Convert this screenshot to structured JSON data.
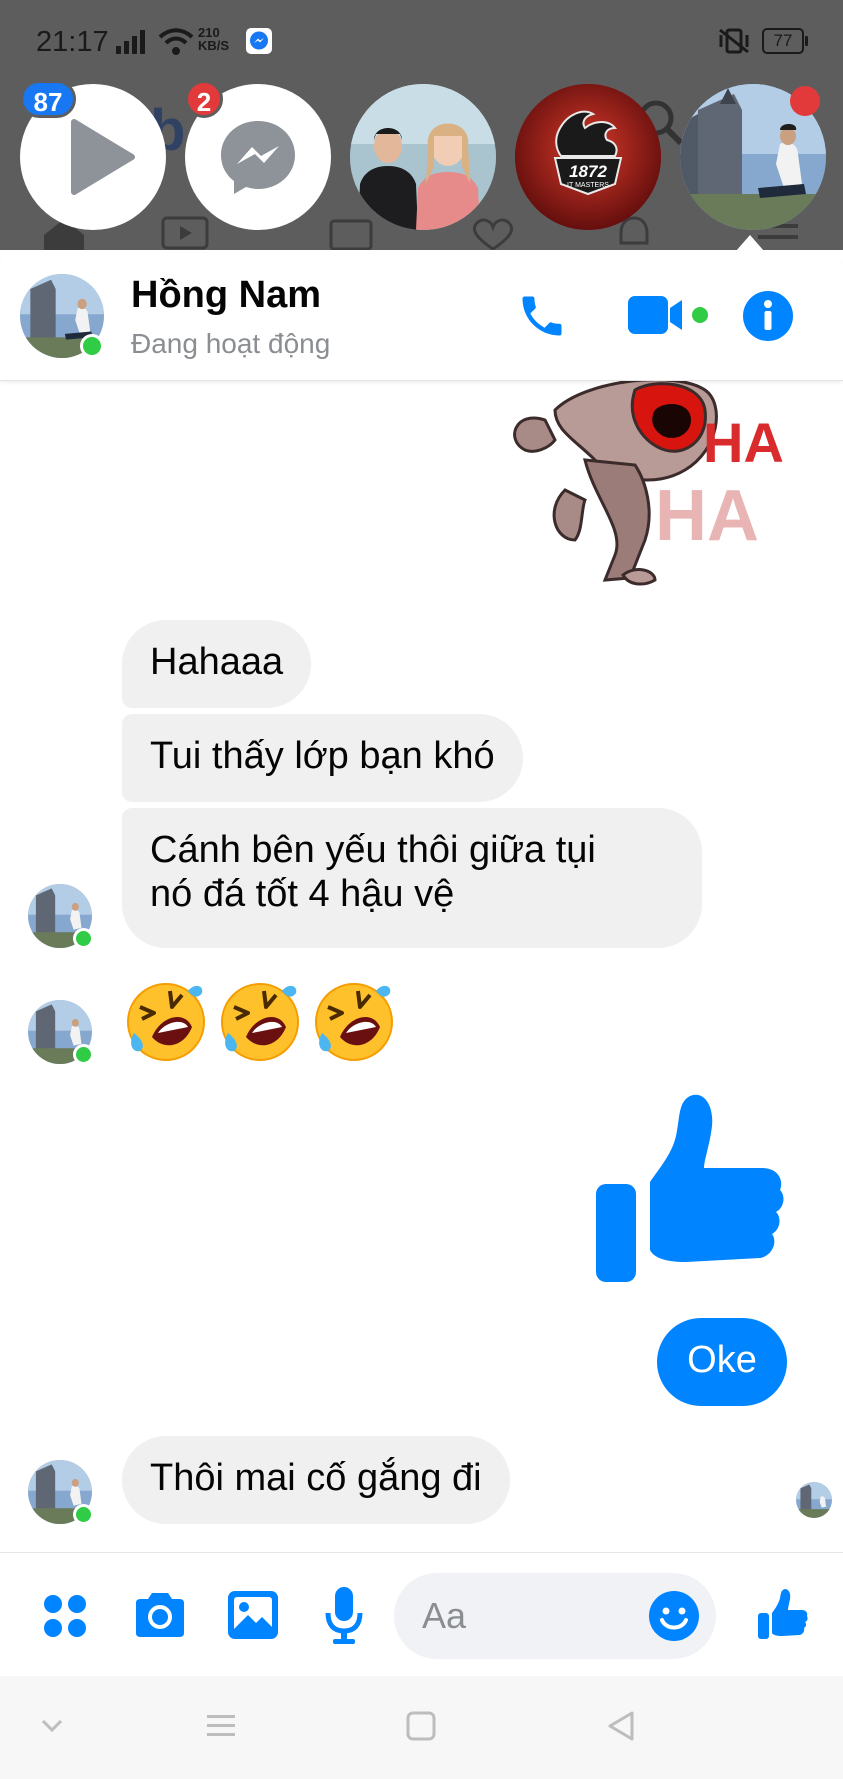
{
  "status_bar": {
    "time": "21:17",
    "speed_value": "210",
    "speed_unit": "KB/S",
    "battery": "77"
  },
  "chat_heads": {
    "video_badge": "87",
    "messenger_badge": "2",
    "logo_text": "1872",
    "logo_subtext": "IT MASTERS"
  },
  "header": {
    "name": "Hồng Nam",
    "status": "Đang hoạt động"
  },
  "sticker": {
    "text_1": "HA",
    "text_2": "HA"
  },
  "messages": {
    "m1": "Hahaaa",
    "m2": "Tui thấy lớp bạn khó",
    "m3_line1": "Cánh bên yếu thôi giữa tụi",
    "m3_line2": "nó đá tốt 4 hậu vệ",
    "emoji": "🤣🤣🤣",
    "m4_out": "Oke",
    "m5": "Thôi mai cố gắng đi"
  },
  "composer": {
    "placeholder": "Aa"
  },
  "colors": {
    "messenger_blue": "#0084ff",
    "online_green": "#31cc46",
    "badge_red": "#e23a3a",
    "badge_blue": "#1877f2"
  }
}
